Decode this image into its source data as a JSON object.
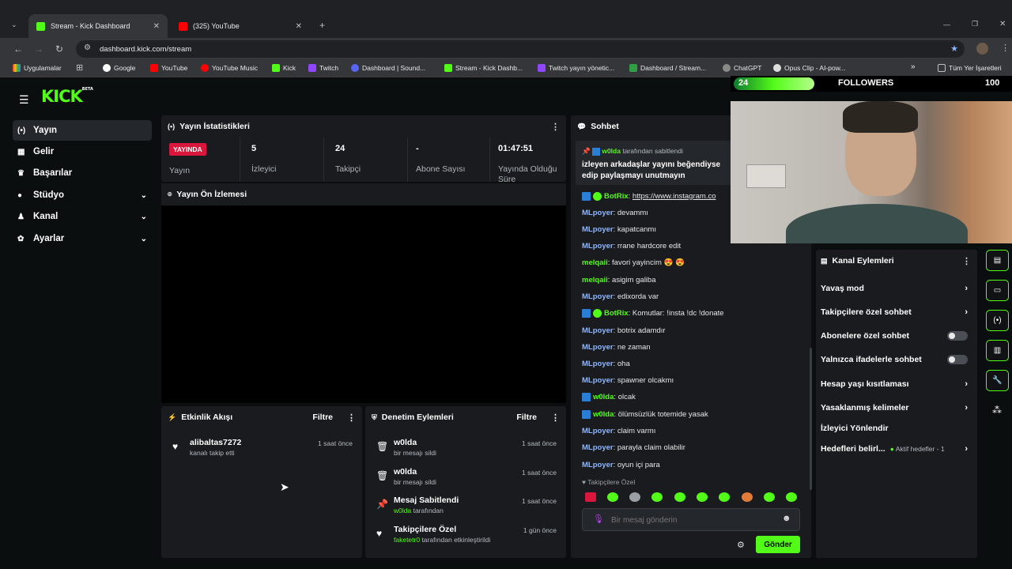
{
  "browser": {
    "tabs": [
      {
        "title": "Stream - Kick Dashboard"
      },
      {
        "title": "(325) YouTube"
      }
    ],
    "url": "dashboard.kick.com/stream",
    "bookmarks": [
      "Uygulamalar",
      "Google",
      "YouTube",
      "YouTube Music",
      "Kick",
      "Twitch",
      "Dashboard | Sound...",
      "Stream - Kick Dashb...",
      "Twitch yayın yönetic...",
      "Dashboard / Stream...",
      "ChatGPT",
      "Opus Clip - AI-pow..."
    ],
    "all_bookmarks": "Tüm Yer İşaretleri"
  },
  "colors": {
    "brand": "#53fc18",
    "live": "#d9163b",
    "mention": "#8fb7ff"
  },
  "overlay": {
    "count": "24",
    "label": "FOLLOWERS",
    "goal": "100",
    "progress": 0.24
  },
  "sidebar": {
    "items": [
      {
        "label": "Yayın",
        "icon": "broadcast-icon"
      },
      {
        "label": "Gelir",
        "icon": "revenue-icon"
      },
      {
        "label": "Başarılar",
        "icon": "trophy-icon"
      },
      {
        "label": "Stüdyo",
        "icon": "palette-icon"
      },
      {
        "label": "Kanal",
        "icon": "user-icon"
      },
      {
        "label": "Ayarlar",
        "icon": "gear-icon"
      }
    ]
  },
  "stats": {
    "title": "Yayın İstatistikleri",
    "live_badge": "YAYINDA",
    "live_label": "Yayın",
    "viewers": {
      "value": "5",
      "label": "İzleyici"
    },
    "followers": {
      "value": "24",
      "label": "Takipçi"
    },
    "subs": {
      "value": "-",
      "label": "Abone Sayısı"
    },
    "duration": {
      "value": "01:47:51",
      "label": "Yayında Olduğu Süre"
    }
  },
  "preview": {
    "title": "Yayın Ön İzlemesi"
  },
  "activity": {
    "title": "Etkinlik Akışı",
    "filter": "Filtre",
    "items": [
      {
        "title": "alibaltas7272",
        "sub": "kanalı takip etti",
        "time": "1 saat önce"
      }
    ]
  },
  "moderation": {
    "title": "Denetim Eylemleri",
    "filter": "Filtre",
    "items": [
      {
        "title": "w0lda",
        "sub": "bir mesajı sildi",
        "time": "1 saat önce"
      },
      {
        "title": "w0lda",
        "sub": "bir mesajı sildi",
        "time": "1 saat önce"
      },
      {
        "title": "Mesaj Sabitlendi",
        "sub_user": "w0lda",
        "sub": " tarafından",
        "time": "1 saat önce"
      },
      {
        "title": "Takipçilere Özel",
        "sub_user": "faketetr0",
        "sub": " tarafından etkinleştirildi",
        "time": "1 gün önce"
      }
    ]
  },
  "chat": {
    "title": "Sohbet",
    "pinned_by": "w0lda",
    "pinned_suffix": "tarafından sabitlendi",
    "pinned_line1": "izleyen arkadaşlar yayını beğendiyse",
    "pinned_line2": "edip paylaşmayı unutmayın",
    "messages": [
      {
        "user": "BotRix",
        "text": "https://www.instagram.co"
      },
      {
        "user": "MLpoyer",
        "text": "devammı"
      },
      {
        "user": "MLpoyer",
        "text": "kapatcanmı"
      },
      {
        "user": "MLpoyer",
        "text": "rrane hardcore edit"
      },
      {
        "user": "melqaii",
        "text": "favori yayincim 😍 😍"
      },
      {
        "user": "melqaii",
        "text": "asigim galiba"
      },
      {
        "user": "MLpoyer",
        "text": "edixorda var"
      },
      {
        "user": "BotRix",
        "text": "Komutlar: !insta !dc !donate"
      },
      {
        "user": "MLpoyer",
        "text": "botrix adamdır"
      },
      {
        "user": "MLpoyer",
        "text": "ne zaman"
      },
      {
        "user": "MLpoyer",
        "text": "oha"
      },
      {
        "user": "MLpoyer",
        "text": "spawner olcakmı"
      },
      {
        "user": "w0lda",
        "text": "olcak"
      },
      {
        "user": "w0lda",
        "text": "ölümsüzlük totemide yasak"
      },
      {
        "user": "MLpoyer",
        "text": "claim varmı"
      },
      {
        "user": "MLpoyer",
        "text": "parayla claim olabilir"
      },
      {
        "user": "MLpoyer",
        "text": "oyun içi para"
      }
    ],
    "followers_only": "Takipçilere Özel",
    "placeholder": "Bir mesaj gönderin",
    "send": "Gönder"
  },
  "channel_actions": {
    "title": "Kanal Eylemleri",
    "items": [
      {
        "label": "Yavaş mod",
        "type": "chevron"
      },
      {
        "label": "Takipçilere özel sohbet",
        "type": "chevron"
      },
      {
        "label": "Abonelere özel sohbet",
        "type": "toggle"
      },
      {
        "label": "Yalnızca ifadelerle sohbet",
        "type": "toggle"
      },
      {
        "label": "Hesap yaşı kısıtlaması",
        "type": "chevron"
      },
      {
        "label": "Yasaklanmış kelimeler",
        "type": "chevron"
      },
      {
        "label": "İzleyici Yönlendir",
        "type": "none"
      },
      {
        "label": "Hedefleri belirl...",
        "type": "goal"
      }
    ],
    "goal_text": "Aktif hedefler - 1"
  }
}
